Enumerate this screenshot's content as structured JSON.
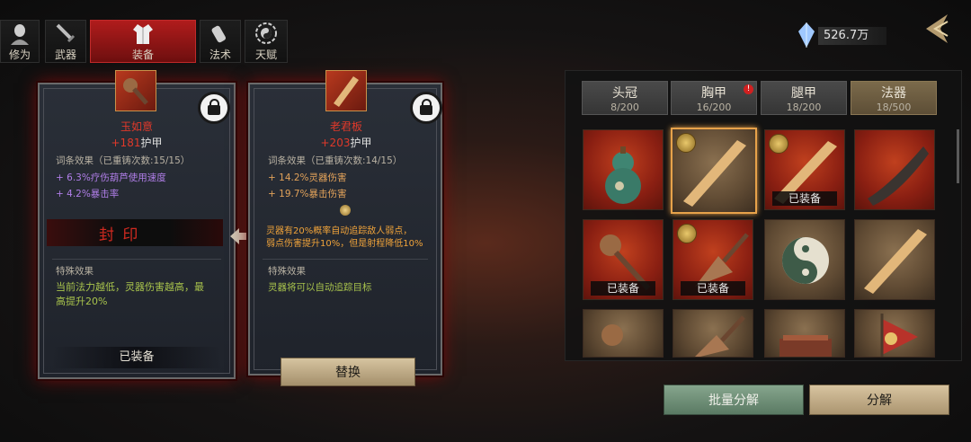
{
  "top_tabs": [
    {
      "label": "修为",
      "icon": "head-icon"
    },
    {
      "label": "武器",
      "icon": "sword-icon"
    },
    {
      "label": "装备",
      "icon": "robe-icon",
      "active": true
    },
    {
      "label": "法术",
      "icon": "scroll-icon"
    },
    {
      "label": "天赋",
      "icon": "bagua-icon"
    }
  ],
  "currency": {
    "value": "526.7万",
    "icon": "crystal-icon"
  },
  "left_card": {
    "name": "玉如意",
    "armor_value": "+181",
    "armor_label": "护甲",
    "entry_header": "词条效果（已重铸次数:15/15）",
    "entries": [
      "+ 6.3%疗伤葫芦使用速度",
      "+ 4.2%暴击率"
    ],
    "seal_text": "封  印",
    "special_header": "特殊效果",
    "special_text": "当前法力越低，灵器伤害越高，最高提升20%",
    "equipped_label": "已装备"
  },
  "right_card": {
    "name": "老君板",
    "armor_value": "+203",
    "armor_label": "护甲",
    "entry_header": "词条效果（已重铸次数:14/15）",
    "entries": [
      "+ 14.2%灵器伤害",
      "+ 19.7%暴击伤害"
    ],
    "spirit_line1": "灵器有20%概率自动追踪敌人弱点，",
    "spirit_line2": "弱点伤害提升10%，但是射程降低10%",
    "special_header": "特殊效果",
    "special_text": "灵器将可以自动追踪目标",
    "replace_label": "替换"
  },
  "categories": [
    {
      "name": "头冠",
      "count": "8/200"
    },
    {
      "name": "胸甲",
      "count": "16/200",
      "alert": "!"
    },
    {
      "name": "腿甲",
      "count": "18/200"
    },
    {
      "name": "法器",
      "count": "18/500",
      "selected": true
    }
  ],
  "grid": [
    {
      "item": "gourd",
      "bg": "red",
      "badge": ""
    },
    {
      "item": "plank",
      "bg": "gold",
      "badge": "",
      "selected": true,
      "coin": true
    },
    {
      "item": "plank",
      "bg": "red",
      "badge": "已装备",
      "coin": true
    },
    {
      "item": "horn",
      "bg": "red",
      "badge": ""
    },
    {
      "item": "ruyi",
      "bg": "red",
      "badge": "已装备"
    },
    {
      "item": "whisk",
      "bg": "red",
      "badge": "已装备",
      "coin": true
    },
    {
      "item": "taiji",
      "bg": "gold",
      "badge": ""
    },
    {
      "item": "plank",
      "bg": "gold",
      "badge": ""
    },
    {
      "item": "ruyi",
      "bg": "gold",
      "badge": ""
    },
    {
      "item": "whisk",
      "bg": "gold",
      "badge": ""
    },
    {
      "item": "vessel",
      "bg": "gold",
      "badge": ""
    },
    {
      "item": "banner",
      "bg": "gold",
      "badge": ""
    }
  ],
  "buttons": {
    "batch": "批量分解",
    "single": "分解"
  },
  "colors": {
    "accent_red": "#b01c1c",
    "gold": "#c9a46a",
    "green_button": "#6f8e78",
    "tan_button": "#c9b48e"
  }
}
